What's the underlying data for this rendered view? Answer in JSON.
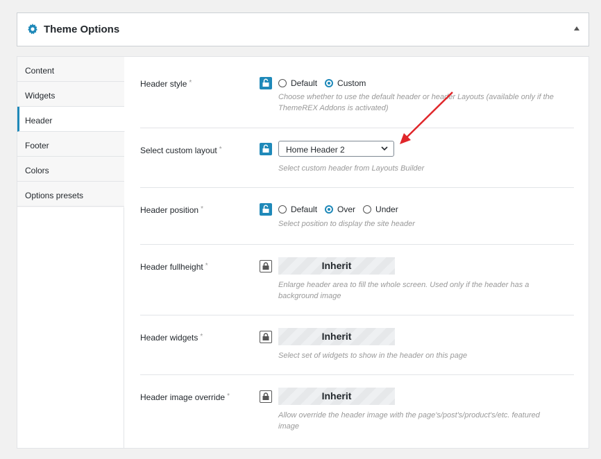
{
  "panel": {
    "title": "Theme Options"
  },
  "tabs": [
    "Content",
    "Widgets",
    "Header",
    "Footer",
    "Colors",
    "Options presets"
  ],
  "rows": {
    "header_style": {
      "label": "Header style",
      "req": "*",
      "options": [
        "Default",
        "Custom"
      ],
      "desc": "Choose whether to use the default header or header Layouts (available only if the ThemeREX Addons is activated)"
    },
    "custom_layout": {
      "label": "Select custom layout",
      "req": "*",
      "value": "Home Header 2",
      "desc": "Select custom header from Layouts Builder"
    },
    "header_position": {
      "label": "Header position",
      "req": "*",
      "options": [
        "Default",
        "Over",
        "Under"
      ],
      "desc": "Select position to display the site header"
    },
    "header_fullheight": {
      "label": "Header fullheight",
      "req": "*",
      "value": "Inherit",
      "desc": "Enlarge header area to fill the whole screen. Used only if the header has a background image"
    },
    "header_widgets": {
      "label": "Header widgets",
      "req": "*",
      "value": "Inherit",
      "desc": "Select set of widgets to show in the header on this page"
    },
    "header_image_override": {
      "label": "Header image override",
      "req": "*",
      "value": "Inherit",
      "desc": "Allow override the header image with the page's/post's/product's/etc. featured image"
    }
  },
  "colors": {
    "accent": "#1f89b9",
    "annotation_arrow": "#e0262a"
  },
  "icons": {
    "panel": "gear-icon",
    "toggle": "chevron-up-icon",
    "lock_on": "unlock-icon",
    "lock_off": "lock-icon"
  }
}
